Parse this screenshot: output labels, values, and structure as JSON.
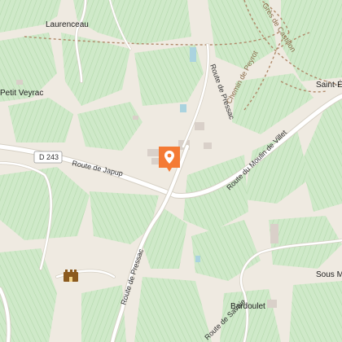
{
  "map": {
    "colors": {
      "background": "#efeae1",
      "vineyard": "#cfe9c9",
      "vineyard_hatch": "#b4d9ac",
      "road": "#ffffff",
      "road_casing": "#d6d0c4",
      "trail": "#b08a6a",
      "water": "#aad3df",
      "building": "#d9d0c9",
      "marker": "#f47a34"
    },
    "places": [
      {
        "name": "Laurenceau"
      },
      {
        "name": "Petit Veyrac"
      },
      {
        "name": "Saint-É"
      },
      {
        "name": "Sous M"
      },
      {
        "name": "Bardoulet"
      }
    ],
    "roads": [
      {
        "name": "D 243"
      },
      {
        "name": "Route de Japup"
      },
      {
        "name": "Route de Pressac"
      },
      {
        "name": "Route du Moulin de Villet"
      },
      {
        "name": "Route de Pressac"
      },
      {
        "name": "Route de Savoie"
      }
    ],
    "trails": [
      {
        "name": "Chemin de Peyrot"
      },
      {
        "name": "Grès de Castillon"
      }
    ],
    "marker": {
      "icon": "map-pin-icon"
    },
    "poi": {
      "icon": "castle-icon"
    }
  }
}
